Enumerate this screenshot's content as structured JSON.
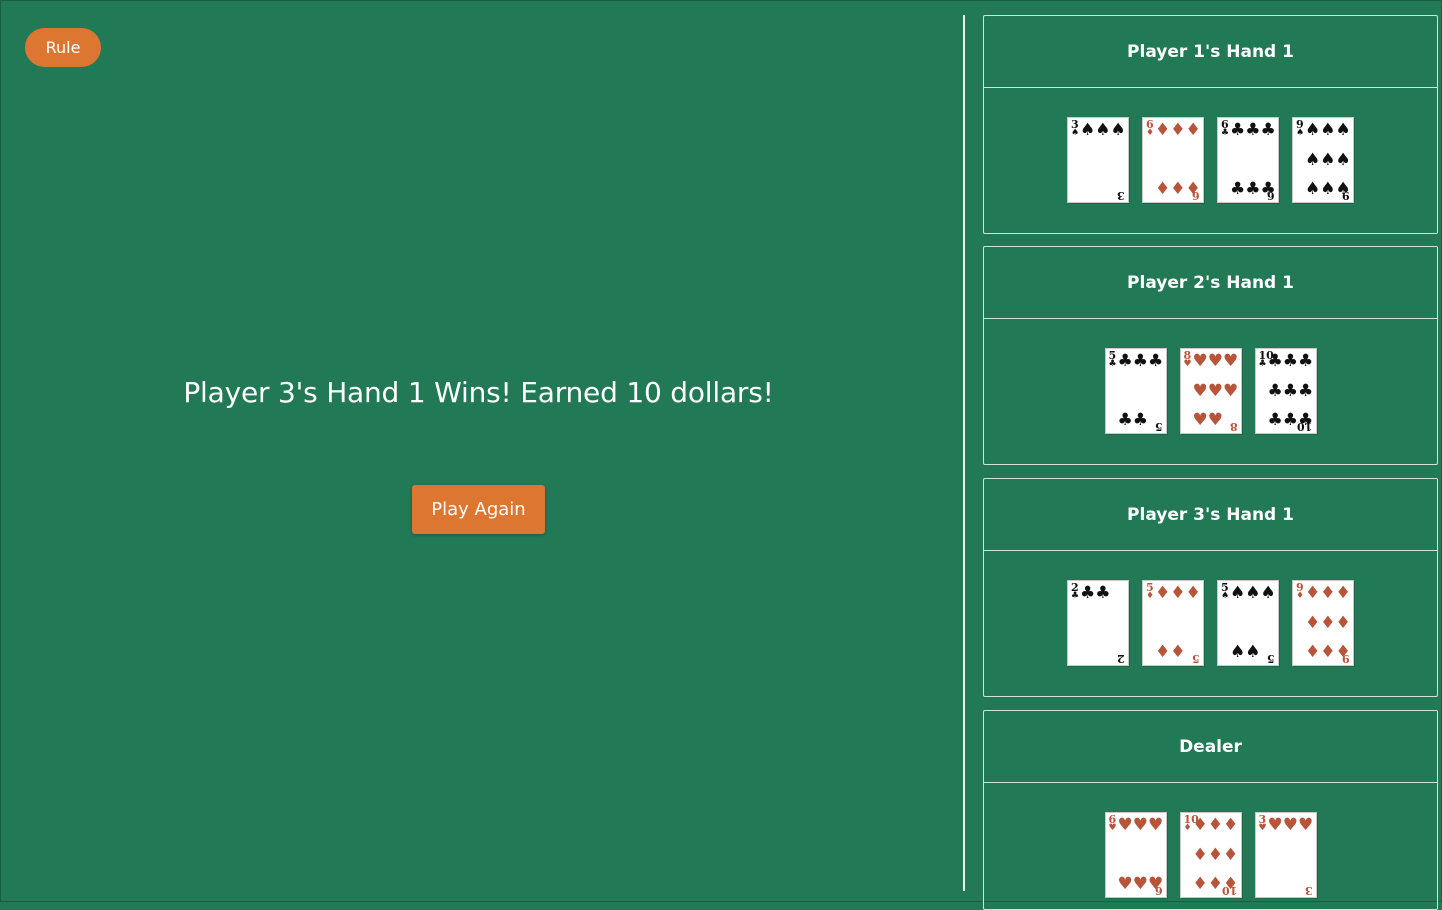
{
  "rule_button": "Rule",
  "message": "Player 3's Hand 1 Wins! Earned 10 dollars!",
  "play_again_button": "Play Again",
  "hands": [
    {
      "title": "Player 1's Hand 1",
      "cards": [
        {
          "rank": "3",
          "suit": "spades"
        },
        {
          "rank": "6",
          "suit": "diamonds"
        },
        {
          "rank": "6",
          "suit": "clubs"
        },
        {
          "rank": "9",
          "suit": "spades"
        }
      ]
    },
    {
      "title": "Player 2's Hand 1",
      "cards": [
        {
          "rank": "5",
          "suit": "clubs"
        },
        {
          "rank": "8",
          "suit": "hearts"
        },
        {
          "rank": "10",
          "suit": "clubs"
        }
      ]
    },
    {
      "title": "Player 3's Hand 1",
      "cards": [
        {
          "rank": "2",
          "suit": "clubs"
        },
        {
          "rank": "5",
          "suit": "diamonds"
        },
        {
          "rank": "5",
          "suit": "spades"
        },
        {
          "rank": "9",
          "suit": "diamonds"
        }
      ]
    },
    {
      "title": "Dealer",
      "cards": [
        {
          "rank": "6",
          "suit": "hearts"
        },
        {
          "rank": "10",
          "suit": "diamonds"
        },
        {
          "rank": "3",
          "suit": "hearts"
        }
      ]
    }
  ],
  "colors": {
    "table_green": "#217a55",
    "button_orange": "#dd7630",
    "red_suit": "#b8543a"
  }
}
